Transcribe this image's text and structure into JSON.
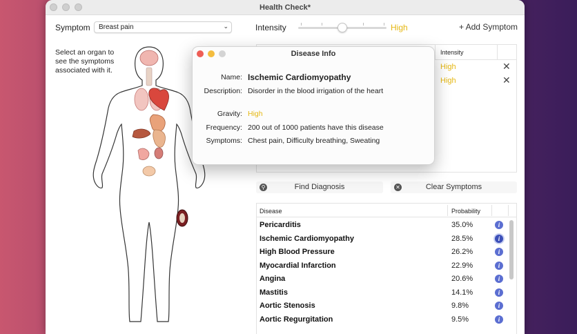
{
  "window": {
    "title": "Health Check*"
  },
  "toolbar": {
    "symptom_label": "Symptom",
    "symptom_value": "Breast pain",
    "intensity_label": "Intensity",
    "intensity_value": "High",
    "intensity_level": 0.5,
    "add_symptom_label": "+ Add Symptom"
  },
  "intro_text": "Select an organ to see the symptoms associated with it.",
  "symptom_table": {
    "header_intensity": "Intensity",
    "rows": [
      {
        "intensity": "High"
      },
      {
        "intensity": "High"
      }
    ]
  },
  "buttons": {
    "find_diagnosis": "Find Diagnosis",
    "clear_symptoms": "Clear Symptoms"
  },
  "disease_table": {
    "header_disease": "Disease",
    "header_probability": "Probability",
    "rows": [
      {
        "name": "Pericarditis",
        "probability": "35.0%"
      },
      {
        "name": "Ischemic Cardiomyopathy",
        "probability": "28.5%"
      },
      {
        "name": "High Blood Pressure",
        "probability": "26.2%"
      },
      {
        "name": "Myocardial Infarction",
        "probability": "22.9%"
      },
      {
        "name": "Angina",
        "probability": "20.6%"
      },
      {
        "name": "Mastitis",
        "probability": "14.1%"
      },
      {
        "name": "Aortic Stenosis",
        "probability": "9.8%"
      },
      {
        "name": "Aortic Regurgitation",
        "probability": "9.5%"
      }
    ]
  },
  "popup": {
    "title": "Disease Info",
    "name_label": "Name:",
    "name_value": "Ischemic Cardiomyopathy",
    "description_label": "Description:",
    "description_value": "Disorder in the blood irrigation of the heart",
    "gravity_label": "Gravity:",
    "gravity_value": "High",
    "frequency_label": "Frequency:",
    "frequency_value": "200 out of 1000 patients have this disease",
    "symptoms_label": "Symptoms:",
    "symptoms_value": "Chest pain, Difficulty breathing, Sweating"
  },
  "colors": {
    "accent_yellow": "#e5b712",
    "info_blue": "#5b6ed1",
    "close_red": "#ee5e56",
    "minimize_yellow": "#f4bd3f"
  }
}
